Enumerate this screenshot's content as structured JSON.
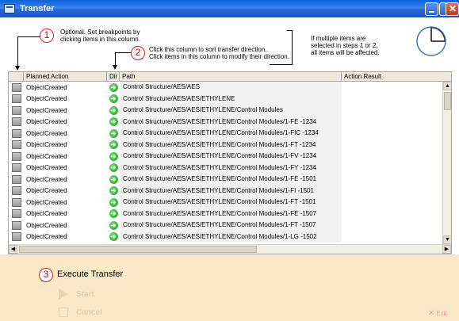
{
  "window": {
    "title": "Transfer"
  },
  "instructions": {
    "step1": {
      "number": "1",
      "line1": "Optional.  Set breakpoints by",
      "line2": "clicking items in this column."
    },
    "step2": {
      "number": "2",
      "line1": "Click this column to sort transfer direction.",
      "line2": "Click items in this column to modify their direction."
    },
    "multi_note": {
      "line1": "If multiple items are",
      "line2": "selected in steps 1 or 2,",
      "line3": "all items will be affected."
    }
  },
  "grid": {
    "columns": [
      "Planned Action",
      "Dir",
      "Path",
      "Action Result"
    ],
    "rows": [
      {
        "action": "ObjectCreated",
        "path": "Control Structure/AES/AES"
      },
      {
        "action": "ObjectCreated",
        "path": "Control Structure/AES/AES/ETHYLENE"
      },
      {
        "action": "ObjectCreated",
        "path": "Control Structure/AES/AES/ETHYLENE/Control Modules"
      },
      {
        "action": "ObjectCreated",
        "path": "Control Structure/AES/AES/ETHYLENE/Control Modules/1-FE   -1234"
      },
      {
        "action": "ObjectCreated",
        "path": "Control Structure/AES/AES/ETHYLENE/Control Modules/1-FIC  -1234"
      },
      {
        "action": "ObjectCreated",
        "path": "Control Structure/AES/AES/ETHYLENE/Control Modules/1-FT   -1234"
      },
      {
        "action": "ObjectCreated",
        "path": "Control Structure/AES/AES/ETHYLENE/Control Modules/1-FV   -1234"
      },
      {
        "action": "ObjectCreated",
        "path": "Control Structure/AES/AES/ETHYLENE/Control Modules/1-FY   -1234"
      },
      {
        "action": "ObjectCreated",
        "path": "Control Structure/AES/AES/ETHYLENE/Control Modules/1-FE   -1501"
      },
      {
        "action": "ObjectCreated",
        "path": "Control Structure/AES/AES/ETHYLENE/Control Modules/1-FI   -1501"
      },
      {
        "action": "ObjectCreated",
        "path": "Control Structure/AES/AES/ETHYLENE/Control Modules/1-FT   -1501"
      },
      {
        "action": "ObjectCreated",
        "path": "Control Structure/AES/AES/ETHYLENE/Control Modules/1-FE   -1507"
      },
      {
        "action": "ObjectCreated",
        "path": "Control Structure/AES/AES/ETHYLENE/Control Modules/1-FT   -1507"
      },
      {
        "action": "ObjectCreated",
        "path": "Control Structure/AES/AES/ETHYLENE/Control Modules/1-LG   -1502"
      }
    ]
  },
  "execute": {
    "step_number": "3",
    "title": "Execute Transfer",
    "start_label": "Start",
    "cancel_label": "Cancel",
    "exit_label": "Exit"
  },
  "icons": {
    "direction": "green-arrow-right-icon",
    "breakpoint": "breakpoint-toggle-icon",
    "pie": "pie-chart-icon"
  },
  "colors": {
    "titlebar": "#0a5fd8",
    "bottom_panel": "#fbe8c8",
    "step_circle": "#d22222",
    "direction_icon": "#1b9a1b"
  }
}
